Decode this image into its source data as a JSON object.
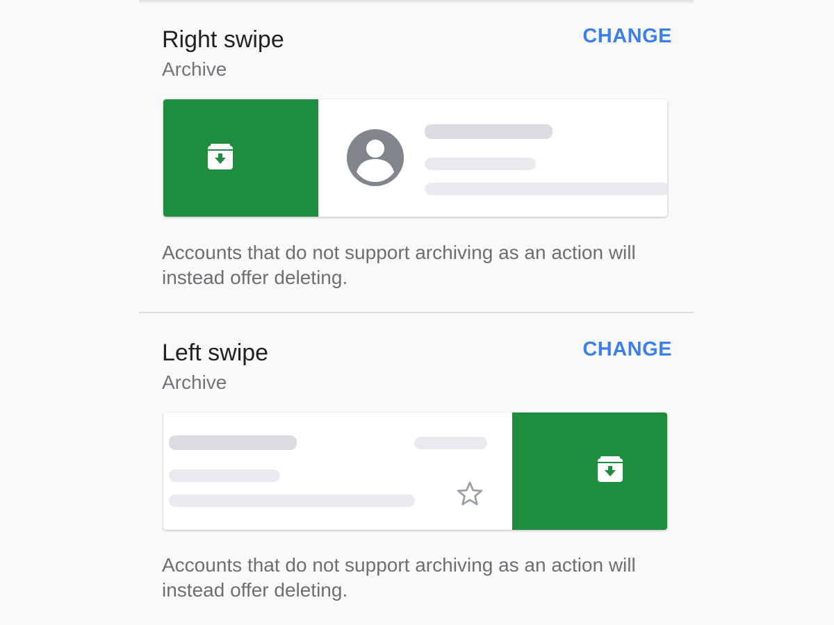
{
  "sections": [
    {
      "title": "Right swipe",
      "value": "Archive",
      "change_label": "CHANGE",
      "action_icon": "archive-icon",
      "note": "Accounts that do not support archiving as an action will instead offer deleting."
    },
    {
      "title": "Left swipe",
      "value": "Archive",
      "change_label": "CHANGE",
      "action_icon": "archive-icon",
      "note": "Accounts that do not support archiving as an action will instead offer deleting."
    }
  ],
  "colors": {
    "action_background": "#1f8d40",
    "accent": "#3c7fe8",
    "avatar": "#80868b"
  }
}
